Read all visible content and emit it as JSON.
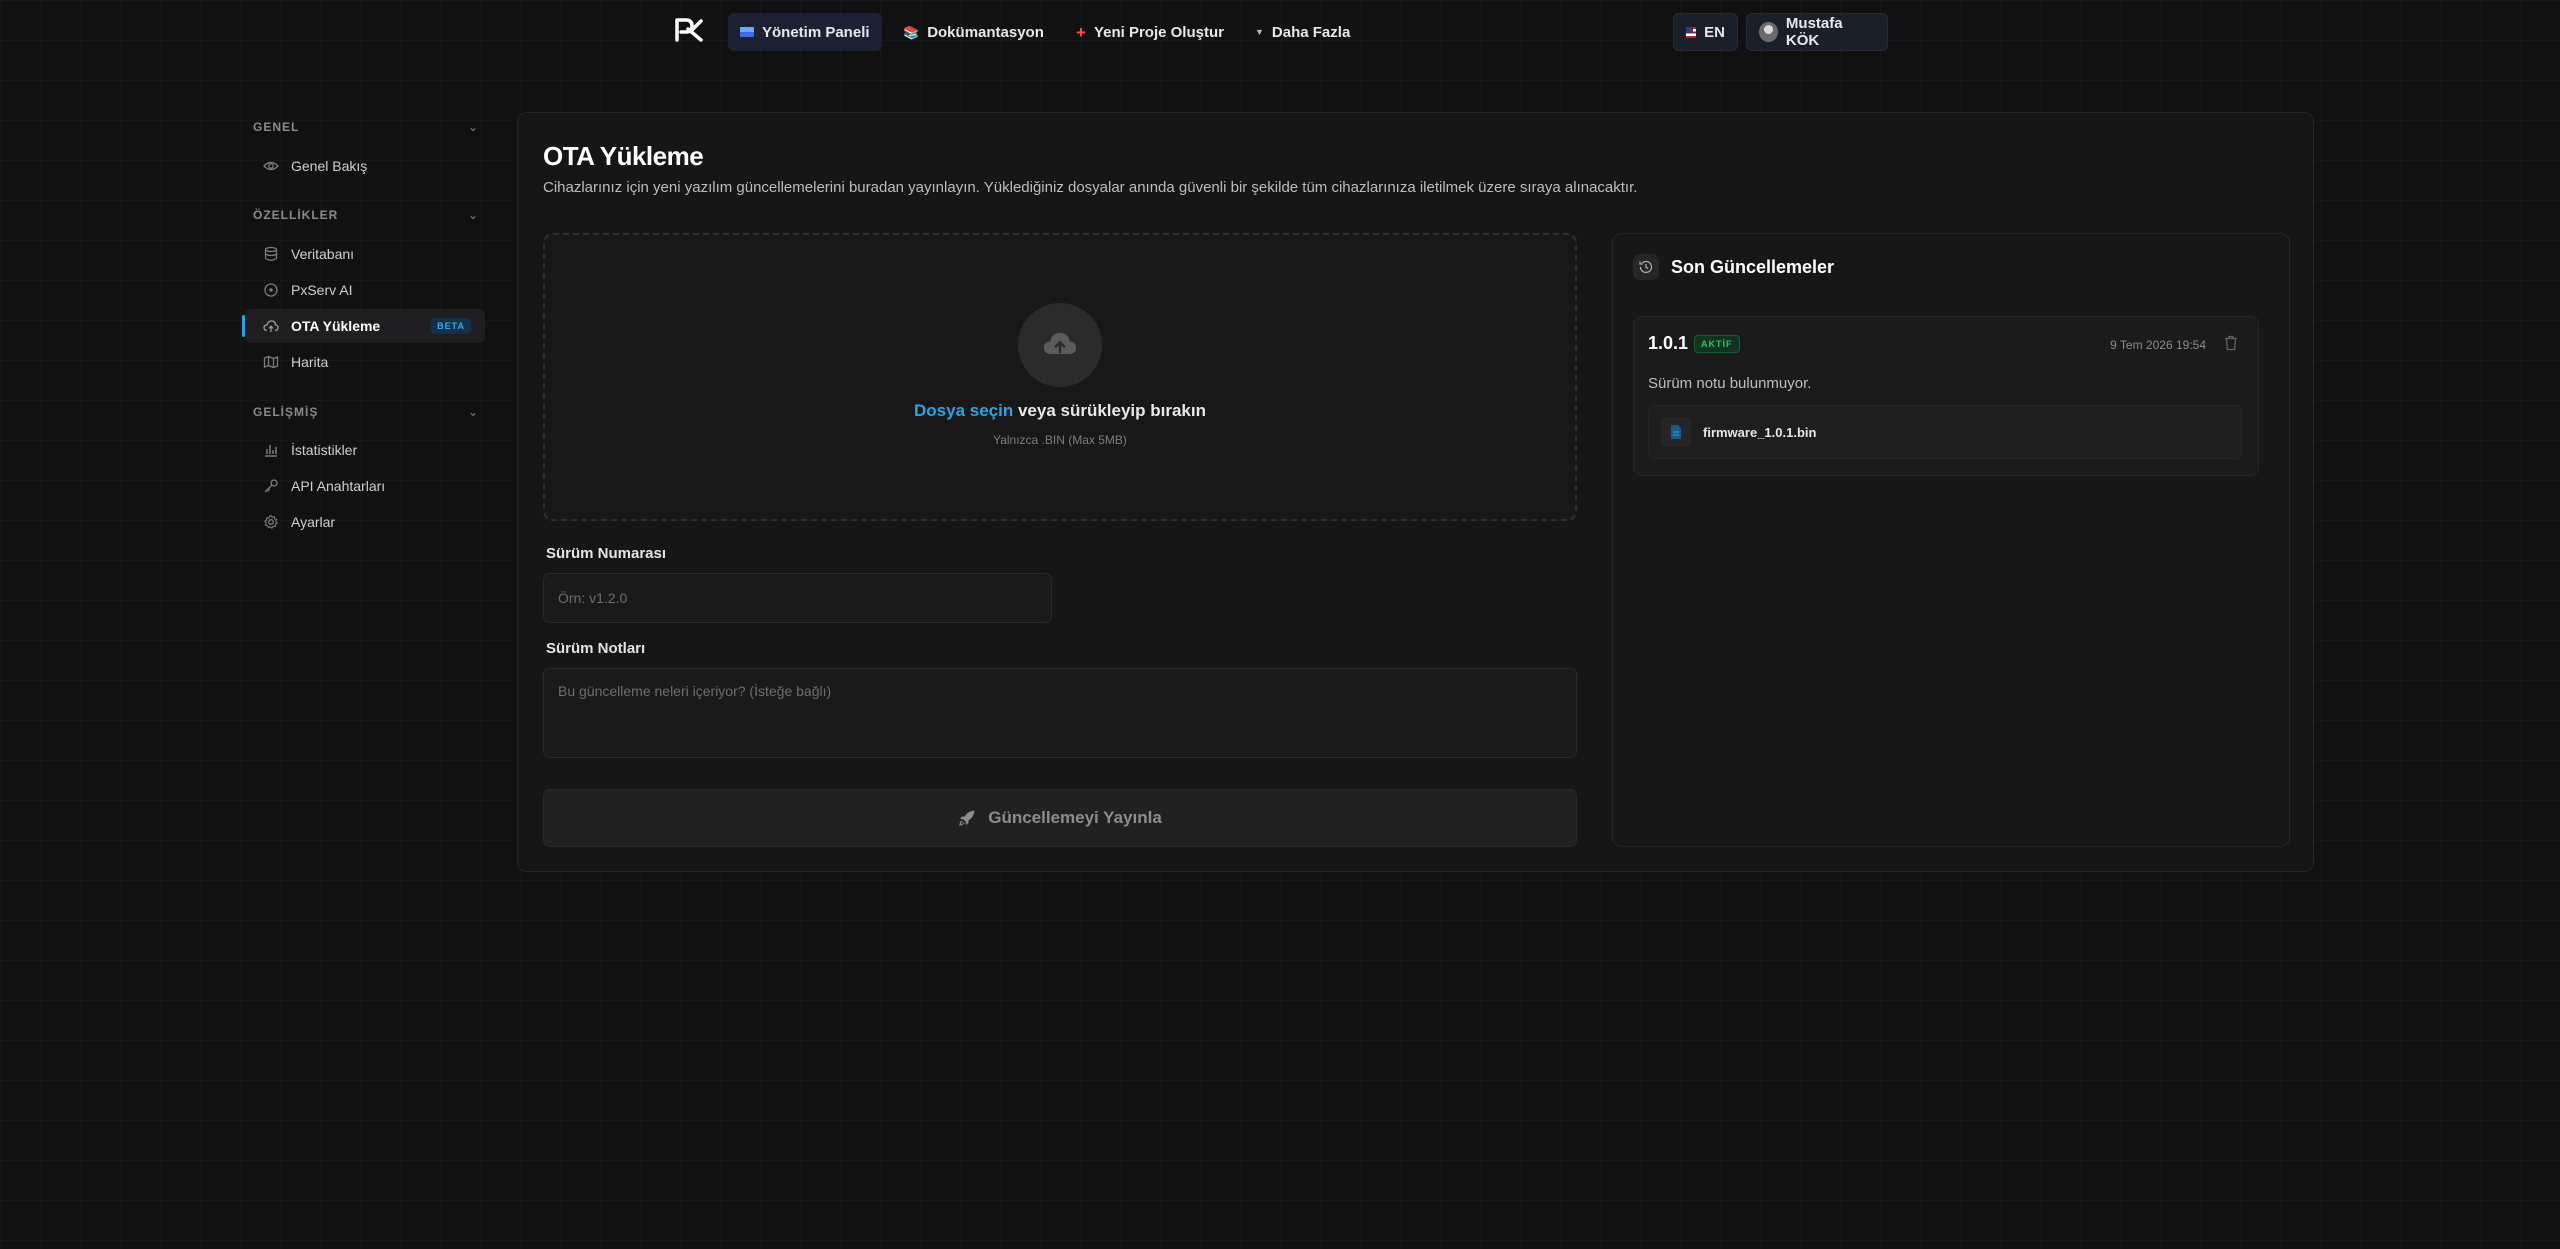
{
  "nav": {
    "items": [
      {
        "label": "Yönetim Paneli",
        "icon": "dashboard-flag-icon"
      },
      {
        "label": "Dokümantasyon",
        "icon": "books-icon"
      },
      {
        "label": "Yeni Proje Oluştur",
        "icon": "plus-icon"
      },
      {
        "label": "Daha Fazla",
        "icon": "chevron-down-icon"
      }
    ],
    "language": "EN",
    "user_name": "Mustafa KÖK"
  },
  "sidebar": {
    "sections": [
      {
        "title": "GENEL",
        "items": [
          {
            "label": "Genel Bakış",
            "icon": "eye-icon"
          }
        ]
      },
      {
        "title": "ÖZELLİKLER",
        "items": [
          {
            "label": "Veritabanı",
            "icon": "database-icon"
          },
          {
            "label": "PxServ AI",
            "icon": "ai-icon"
          },
          {
            "label": "OTA Yükleme",
            "icon": "cloud-upload-icon",
            "badge": "BETA"
          },
          {
            "label": "Harita",
            "icon": "map-icon"
          }
        ]
      },
      {
        "title": "GELİŞMİŞ",
        "items": [
          {
            "label": "İstatistikler",
            "icon": "bar-chart-icon"
          },
          {
            "label": "API Anahtarları",
            "icon": "key-icon"
          },
          {
            "label": "Ayarlar",
            "icon": "gear-icon"
          }
        ]
      }
    ]
  },
  "main": {
    "title": "OTA Yükleme",
    "description": "Cihazlarınız için yeni yazılım güncellemelerini buradan yayınlayın. Yüklediğiniz dosyalar anında güvenli bir şekilde tüm cihazlarınıza iletilmek üzere sıraya alınacaktır.",
    "dropzone": {
      "link_text": "Dosya seçin",
      "text": " veya sürükleyip bırakın",
      "hint": "Yalnızca .BIN (Max 5MB)"
    },
    "version_label": "Sürüm Numarası",
    "version_placeholder": "Örn: v1.2.0",
    "notes_label": "Sürüm Notları",
    "notes_placeholder": "Bu güncelleme neleri içeriyor? (İsteğe bağlı)",
    "publish_label": "Güncellemeyi Yayınla"
  },
  "recent": {
    "title": "Son Güncellemeler",
    "releases": [
      {
        "version": "1.0.1",
        "status": "AKTİF",
        "date": "9 Tem 2026 19:54",
        "notes": "Sürüm notu bulunmuyor.",
        "file": "firmware_1.0.1.bin"
      }
    ]
  },
  "colors": {
    "accent": "#2aa3e6",
    "success": "#22c55e",
    "background": "#111111"
  }
}
